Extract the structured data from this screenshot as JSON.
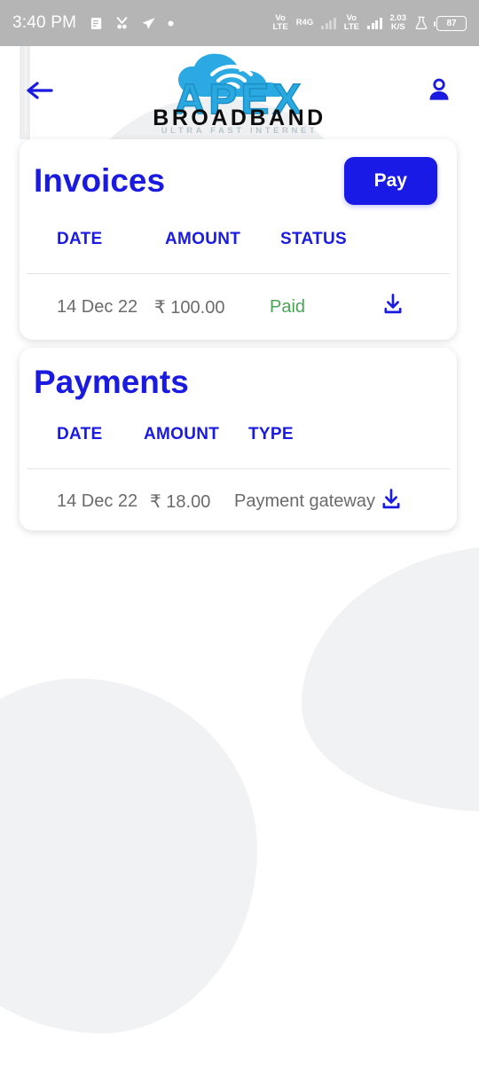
{
  "status_bar": {
    "time": "3:40 PM",
    "left_icons": [
      "document-icon",
      "contacts-icon",
      "telegram-icon",
      "dot-icon"
    ],
    "network_1": {
      "line1": "Vo",
      "line2": "LTE"
    },
    "network_label": "R4G",
    "network_2": {
      "line1": "Vo",
      "line2": "LTE"
    },
    "data_speed": {
      "value": "2.03",
      "unit": "K/S"
    },
    "lab_icon": "flask-icon",
    "battery_level": "87"
  },
  "header": {
    "back_icon": "back-arrow-icon",
    "account_icon": "person-icon",
    "logo": {
      "brand": "APEX",
      "sub_brand": "BROADBAND",
      "tagline": "ULTRA FAST INTERNET",
      "cloud_icon": "wifi-cloud-icon"
    }
  },
  "invoices": {
    "title": "Invoices",
    "pay_label": "Pay",
    "columns": [
      "DATE",
      "AMOUNT",
      "STATUS"
    ],
    "rows": [
      {
        "date": "14 Dec 22",
        "amount": "₹ 100.00",
        "status": "Paid",
        "download_icon": "download-icon"
      }
    ]
  },
  "payments": {
    "title": "Payments",
    "columns": [
      "DATE",
      "AMOUNT",
      "TYPE"
    ],
    "rows": [
      {
        "date": "14 Dec 22",
        "amount": "₹ 18.00",
        "type": "Payment gateway",
        "download_icon": "download-icon"
      }
    ]
  },
  "colors": {
    "brand_blue": "#1a1ae0",
    "button_blue": "#1a1ae6",
    "paid_green": "#4aa455",
    "status_bar_gray": "#b5b5b5",
    "logo_cyan": "#29a9e0",
    "text_gray": "#6b6b6b"
  }
}
